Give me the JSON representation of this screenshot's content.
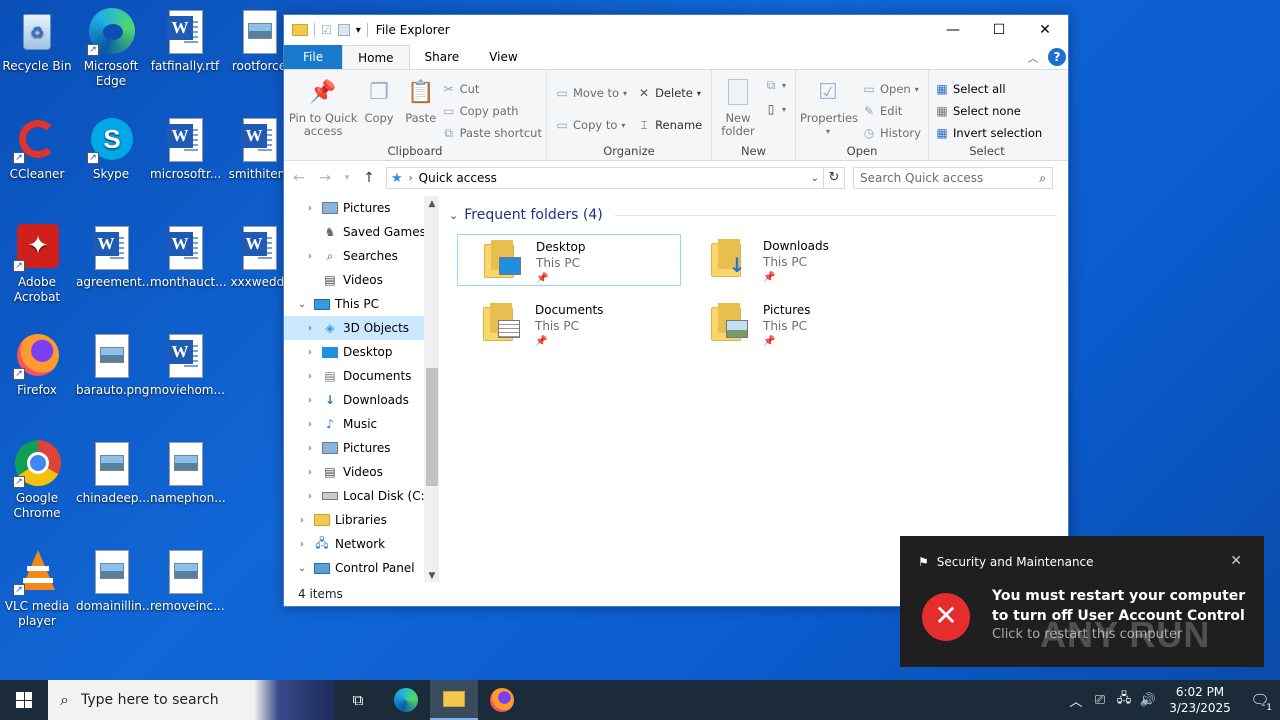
{
  "desktop": {
    "icons": [
      {
        "label": "Recycle Bin"
      },
      {
        "label": "Microsoft Edge"
      },
      {
        "label": "fatfinally.rtf"
      },
      {
        "label": "rootforce"
      },
      {
        "label": "CCleaner"
      },
      {
        "label": "Skype"
      },
      {
        "label": "microsoftr..."
      },
      {
        "label": "smithitem"
      },
      {
        "label": "Adobe Acrobat"
      },
      {
        "label": "agreement..."
      },
      {
        "label": "monthauct..."
      },
      {
        "label": "xxxweddi"
      },
      {
        "label": "Firefox"
      },
      {
        "label": "barauto.png"
      },
      {
        "label": "moviehom..."
      },
      {
        "label": "Google Chrome"
      },
      {
        "label": "chinadeep...."
      },
      {
        "label": "namephon..."
      },
      {
        "label": "VLC media player"
      },
      {
        "label": "domainillin..."
      },
      {
        "label": "removeinc..."
      }
    ]
  },
  "explorer": {
    "title": "File Explorer",
    "tabs": {
      "file": "File",
      "home": "Home",
      "share": "Share",
      "view": "View"
    },
    "ribbon": {
      "clipboard": {
        "name": "Clipboard",
        "pin": "Pin to Quick access",
        "copy": "Copy",
        "paste": "Paste",
        "cut": "Cut",
        "copy_path": "Copy path",
        "paste_shortcut": "Paste shortcut"
      },
      "organize": {
        "name": "Organize",
        "move_to": "Move to",
        "copy_to": "Copy to",
        "delete": "Delete",
        "rename": "Rename"
      },
      "new": {
        "name": "New",
        "new_folder": "New folder"
      },
      "open": {
        "name": "Open",
        "properties": "Properties",
        "open": "Open",
        "edit": "Edit",
        "history": "History"
      },
      "select": {
        "name": "Select",
        "select_all": "Select all",
        "select_none": "Select none",
        "invert": "Invert selection"
      }
    },
    "address": {
      "path": "Quick access",
      "search_placeholder": "Search Quick access"
    },
    "nav_items": [
      {
        "label": "Pictures",
        "icon": "pictures-icon"
      },
      {
        "label": "Saved Games",
        "icon": "saved-games-icon"
      },
      {
        "label": "Searches",
        "icon": "searches-icon"
      },
      {
        "label": "Videos",
        "icon": "videos-icon"
      },
      {
        "label": "This PC",
        "icon": "this-pc-icon"
      },
      {
        "label": "3D Objects",
        "icon": "3d-objects-icon"
      },
      {
        "label": "Desktop",
        "icon": "desktop-icon"
      },
      {
        "label": "Documents",
        "icon": "documents-icon"
      },
      {
        "label": "Downloads",
        "icon": "downloads-icon"
      },
      {
        "label": "Music",
        "icon": "music-icon"
      },
      {
        "label": "Pictures",
        "icon": "pictures-icon"
      },
      {
        "label": "Videos",
        "icon": "videos-icon"
      },
      {
        "label": "Local Disk (C:)",
        "icon": "disk-icon"
      },
      {
        "label": "Libraries",
        "icon": "libraries-icon"
      },
      {
        "label": "Network",
        "icon": "network-icon"
      },
      {
        "label": "Control Panel",
        "icon": "control-panel-icon"
      }
    ],
    "section_title": "Frequent folders (4)",
    "folders": [
      {
        "name": "Desktop",
        "location": "This PC"
      },
      {
        "name": "Downloads",
        "location": "This PC"
      },
      {
        "name": "Documents",
        "location": "This PC"
      },
      {
        "name": "Pictures",
        "location": "This PC"
      }
    ],
    "status": "4 items"
  },
  "toast": {
    "app": "Security and Maintenance",
    "message": "You must restart your computer to turn off User Account Control",
    "action": "Click to restart this computer",
    "watermark": "ANY RUN"
  },
  "taskbar": {
    "search_placeholder": "Type here to search",
    "time": "6:02 PM",
    "date": "3/23/2025",
    "notification_count": "1"
  },
  "colors": {
    "accent": "#1979ca",
    "selection": "#cce8ff",
    "error": "#e52d2d",
    "taskbar": "#1c2b3a"
  }
}
